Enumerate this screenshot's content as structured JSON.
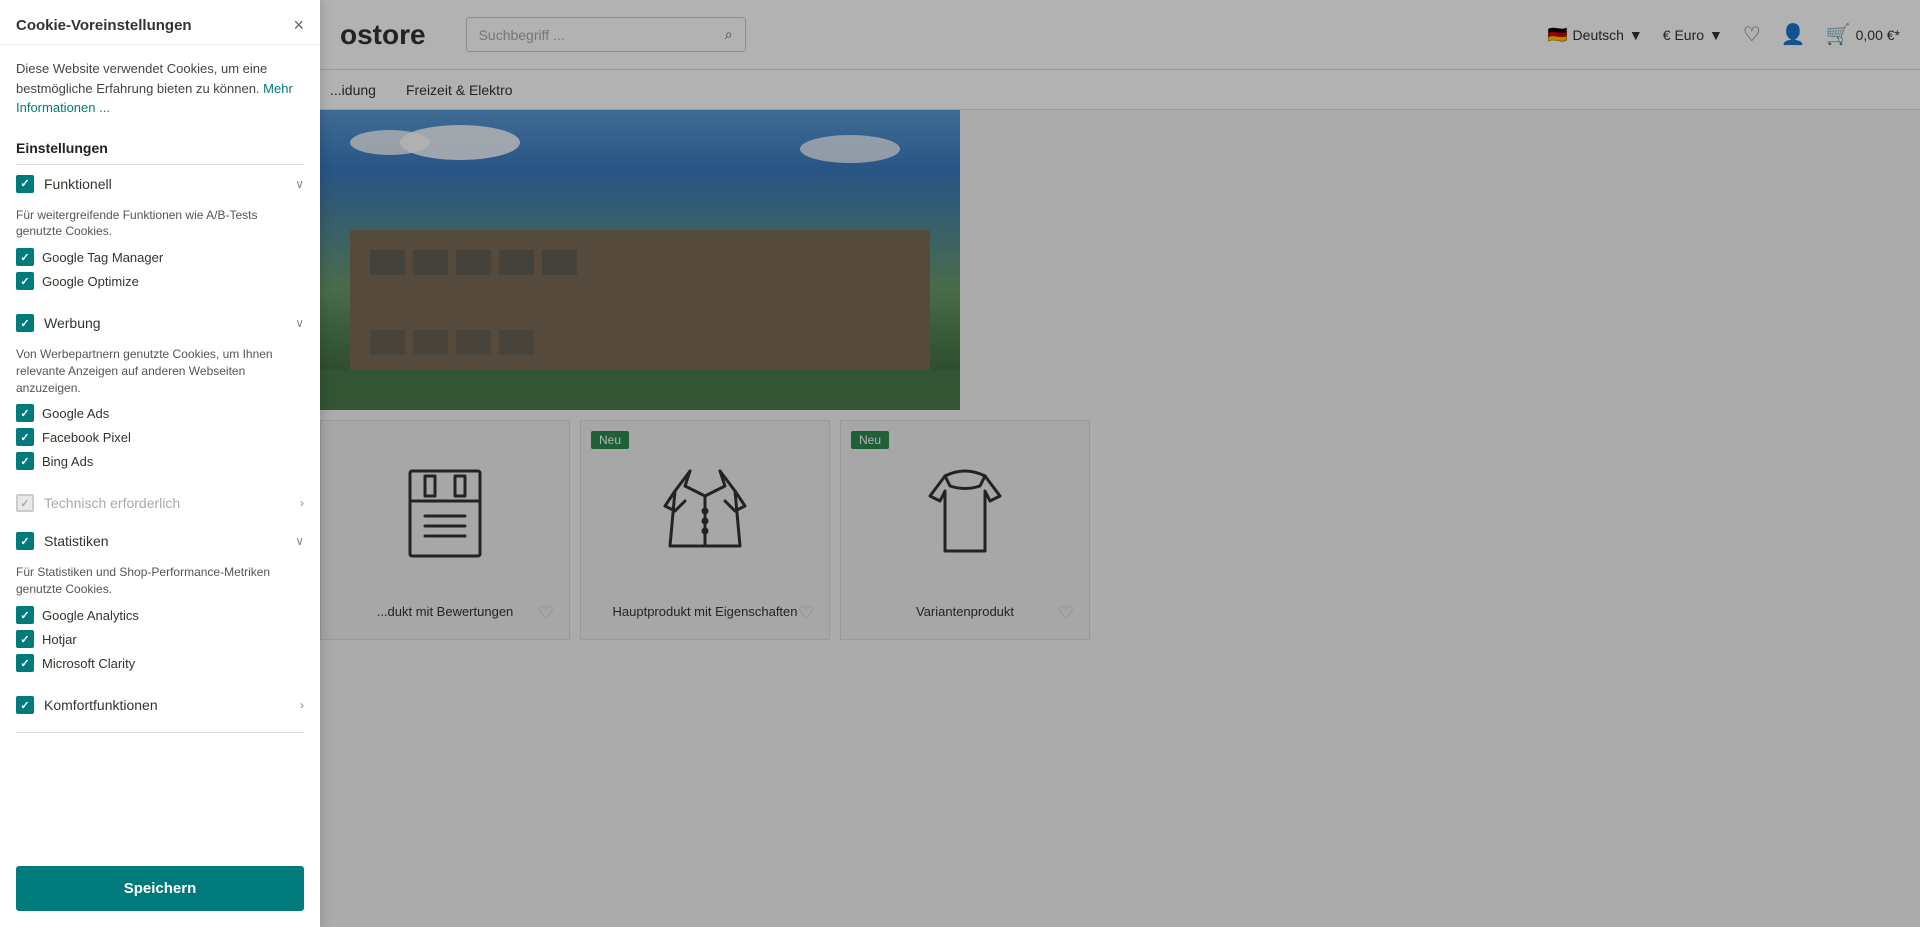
{
  "cookie": {
    "title": "Cookie-Voreinstellungen",
    "close_label": "×",
    "intro_text": "Diese Website verwendet Cookies, um eine bestmögliche Erfahrung bieten zu können.",
    "more_info_text": "Mehr Informationen ...",
    "settings_label": "Einstellungen",
    "categories": [
      {
        "id": "funktionell",
        "label": "Funktionell",
        "checked": true,
        "disabled": false,
        "expanded": true,
        "description": "Für weitergreifende Funktionen wie A/B-Tests genutzte Cookies.",
        "sub_items": [
          {
            "label": "Google Tag Manager",
            "checked": true
          },
          {
            "label": "Google Optimize",
            "checked": true
          }
        ]
      },
      {
        "id": "werbung",
        "label": "Werbung",
        "checked": true,
        "disabled": false,
        "expanded": true,
        "description": "Von Werbepartnern genutzte Cookies, um Ihnen relevante Anzeigen auf anderen Webseiten anzuzeigen.",
        "sub_items": [
          {
            "label": "Google Ads",
            "checked": true
          },
          {
            "label": "Facebook Pixel",
            "checked": true
          },
          {
            "label": "Bing Ads",
            "checked": true
          }
        ]
      },
      {
        "id": "technisch",
        "label": "Technisch erforderlich",
        "checked": true,
        "disabled": true,
        "expanded": false,
        "description": "",
        "sub_items": []
      },
      {
        "id": "statistiken",
        "label": "Statistiken",
        "checked": true,
        "disabled": false,
        "expanded": true,
        "description": "Für Statistiken und Shop-Performance-Metriken genutzte Cookies.",
        "sub_items": [
          {
            "label": "Google Analytics",
            "checked": true
          },
          {
            "label": "Hotjar",
            "checked": true
          },
          {
            "label": "Microsoft Clarity",
            "checked": true
          }
        ]
      },
      {
        "id": "komfort",
        "label": "Komfortfunktionen",
        "checked": true,
        "disabled": false,
        "expanded": false,
        "description": "",
        "sub_items": []
      }
    ],
    "save_label": "Speichern"
  },
  "store": {
    "logo": "ostore",
    "search_placeholder": "Suchbegriff ...",
    "lang": "Deutsch",
    "currency": "€ Euro",
    "cart_price": "0,00 €*",
    "nav_items": [
      "...idung",
      "Freizeit & Elektro"
    ],
    "products": [
      {
        "name": "...dukt mit Bewertungen",
        "badge": null,
        "icon": "shirt-folded"
      },
      {
        "name": "Hauptprodukt mit Eigenschaften",
        "badge": "Neu",
        "icon": "jacket"
      },
      {
        "name": "Variantenprodukt",
        "badge": "Neu",
        "icon": "sweater"
      }
    ]
  }
}
